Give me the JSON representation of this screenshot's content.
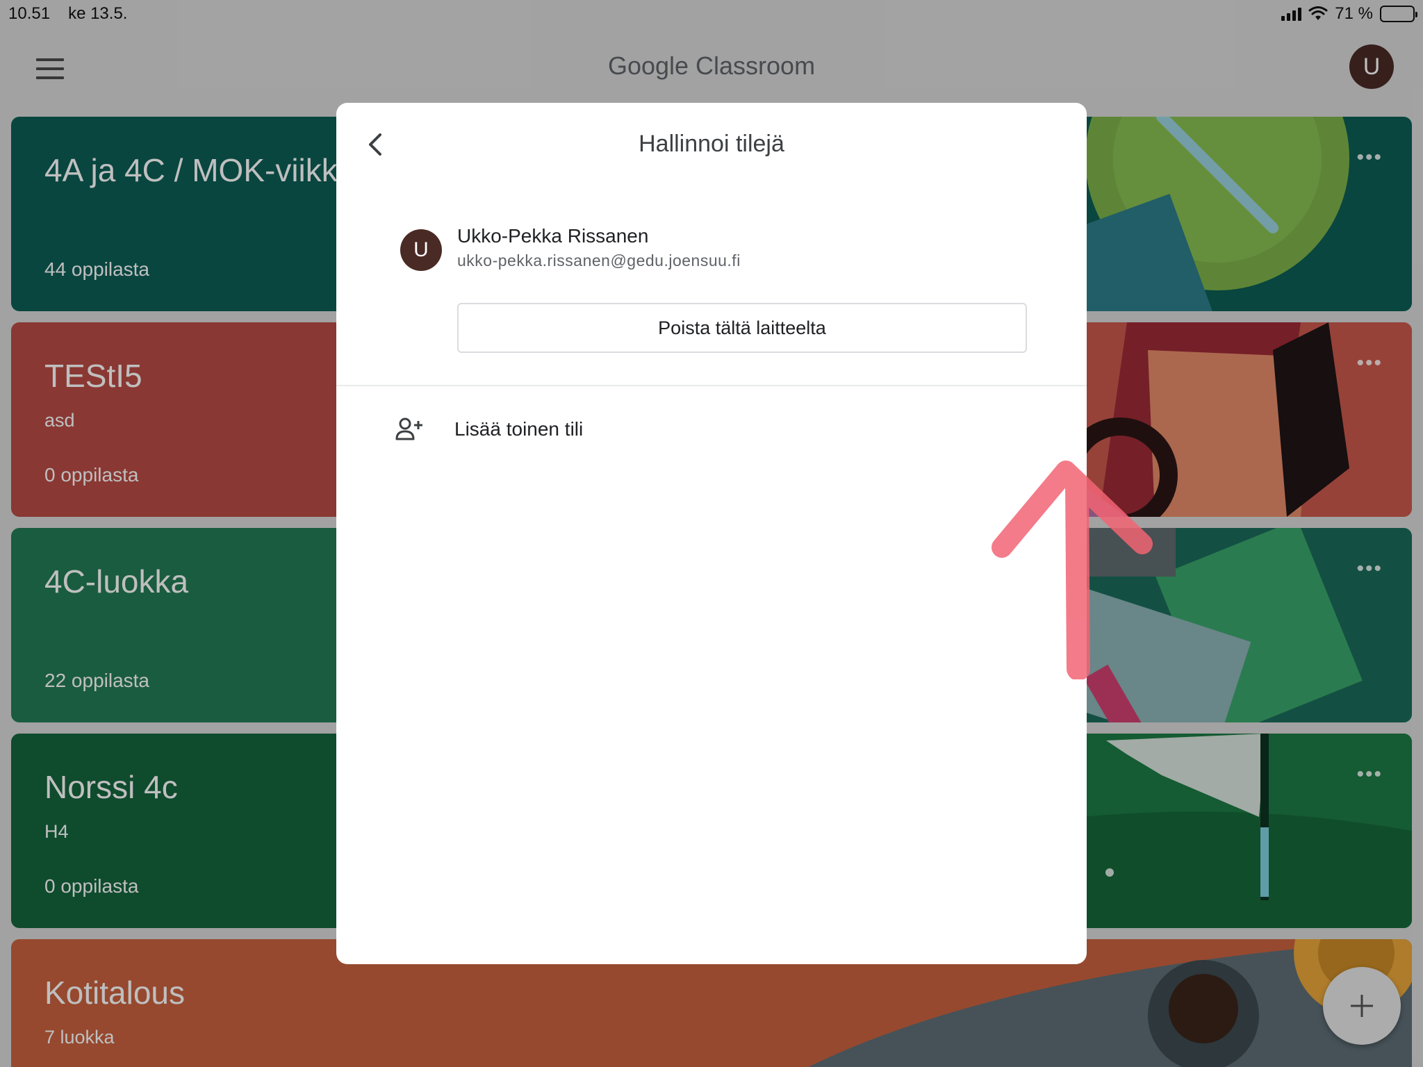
{
  "status_bar": {
    "time": "10.51",
    "date": "ke 13.5.",
    "battery": "71 %",
    "battery_level": 0.71
  },
  "app_bar": {
    "title": "Google Classroom",
    "avatar_letter": "U"
  },
  "classes": [
    {
      "name": "4A ja 4C / MOK-viikko",
      "section": "",
      "count": "44 oppilasta",
      "color": "#0d5e55"
    },
    {
      "name": "TEStI5",
      "section": "asd",
      "count": "0 oppilasta",
      "color": "#b84b45"
    },
    {
      "name": "4C-luokka",
      "section": "",
      "count": "22 oppilasta",
      "color": "#237b55"
    },
    {
      "name": "Norssi 4c",
      "section": "H4",
      "count": "0 oppilasta",
      "color": "#15643d"
    },
    {
      "name": "Kotitalous",
      "section": "7 luokka",
      "count": "",
      "color": "#c8623f"
    }
  ],
  "dialog": {
    "title": "Hallinnoi tilejä",
    "account": {
      "avatar_letter": "U",
      "name": "Ukko-Pekka Rissanen",
      "email": "ukko-pekka.rissanen@gedu.joensuu.fi"
    },
    "remove_button": "Poista tältä laitteelta",
    "add_account": "Lisää toinen tili"
  },
  "icons": {
    "menu": "menu-icon",
    "back": "chevron-left-icon",
    "add_person": "person-add-icon",
    "more": "more-horiz-icon",
    "fab": "plus-icon"
  },
  "colors": {
    "annotation_arrow": "#f26474",
    "avatar": "#4a2a24"
  }
}
